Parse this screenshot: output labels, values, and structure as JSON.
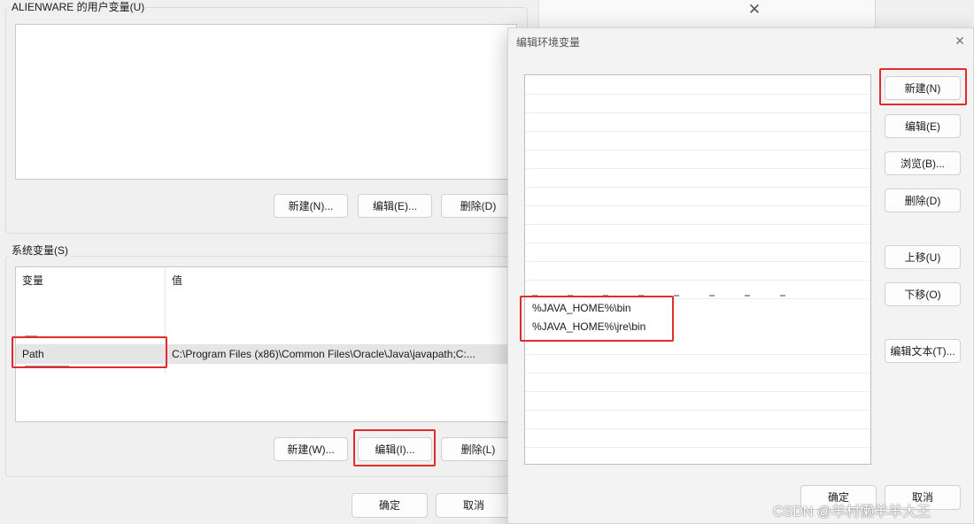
{
  "user_vars": {
    "group_title": "ALIENWARE 的用户变量(U)",
    "buttons": {
      "new": "新建(N)...",
      "edit": "编辑(E)...",
      "delete": "删除(D)"
    }
  },
  "system_vars": {
    "group_title": "系统变量(S)",
    "columns": {
      "variable": "变量",
      "value": "值"
    },
    "selected_row": {
      "name": "Path",
      "value": "C:\\Program Files (x86)\\Common Files\\Oracle\\Java\\javapath;C:..."
    },
    "buttons": {
      "new": "新建(W)...",
      "edit": "编辑(I)...",
      "delete": "删除(L)"
    }
  },
  "footer": {
    "ok": "确定",
    "cancel": "取消"
  },
  "edit_dialog": {
    "title": "编辑环境变量",
    "entries": [
      "%JAVA_HOME%\\bin",
      "%JAVA_HOME%\\jre\\bin"
    ],
    "buttons": {
      "new": "新建(N)",
      "edit": "编辑(E)",
      "browse": "浏览(B)...",
      "delete": "删除(D)",
      "move_up": "上移(U)",
      "move_down": "下移(O)",
      "edit_text": "编辑文本(T)..."
    },
    "footer": {
      "ok": "确定",
      "cancel": "取消"
    }
  },
  "watermark": "CSDN @羊村懒羊羊大王",
  "colors": {
    "highlight": "#e22b2b",
    "selected_row": "#e5e5e5"
  }
}
